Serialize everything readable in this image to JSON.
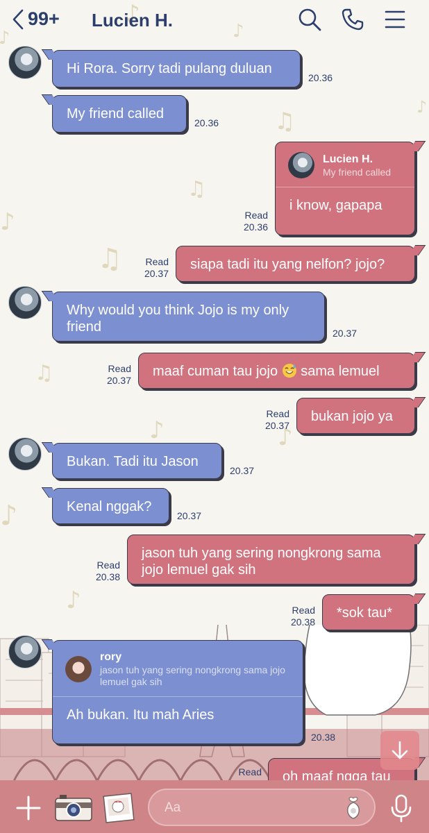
{
  "header": {
    "back_count": "99+",
    "title": "Lucien H.",
    "icons": [
      "chevron-left-icon",
      "search-icon",
      "phone-icon",
      "menu-icon"
    ]
  },
  "messages": {
    "m1": {
      "text": "Hi Rora. Sorry tadi pulang duluan",
      "time": "20.36"
    },
    "m2": {
      "text": "My friend called",
      "time": "20.36"
    },
    "m3": {
      "reply_name": "Lucien H.",
      "reply_text": "My friend called",
      "text": "i know, gapapa",
      "read": "Read",
      "time": "20.36"
    },
    "m4": {
      "text": "siapa tadi itu yang nelfon? jojo?",
      "read": "Read",
      "time": "20.37"
    },
    "m5": {
      "text": "Why would you think Jojo is my only friend",
      "time": "20.37"
    },
    "m6": {
      "text_before": "maaf cuman tau jojo",
      "emoji": "sweat-smile-emoji",
      "text_after": "sama lemuel",
      "read": "Read",
      "time": "20.37"
    },
    "m7": {
      "text": "bukan jojo ya",
      "read": "Read",
      "time": "20.37"
    },
    "m8": {
      "text": "Bukan. Tadi itu Jason",
      "time": "20.37"
    },
    "m9": {
      "text": "Kenal nggak?",
      "time": "20.37"
    },
    "m10": {
      "text": "jason tuh yang sering nongkrong sama jojo lemuel gak sih",
      "read": "Read",
      "time": "20.38"
    },
    "m11": {
      "text": "*sok tau*",
      "read": "Read",
      "time": "20.38"
    },
    "m12": {
      "reply_name": "rory",
      "reply_text": "jason tuh yang sering nongkrong sama jojo lemuel gak sih",
      "text": "Ah bukan. Itu mah Aries",
      "time": "20.38"
    },
    "m13": {
      "text": "oh maaf ngga tau",
      "read": "Read"
    }
  },
  "input": {
    "placeholder": "Aa"
  },
  "bottom_icons": [
    "plus-icon",
    "camera-icon",
    "photo-icon",
    "sticker-icon",
    "microphone-icon"
  ],
  "colors": {
    "incoming_bubble": "#7c8fd1",
    "outgoing_bubble": "#d0737f",
    "bottom_bar": "#cf8487",
    "header_text": "#2c3e6b"
  }
}
